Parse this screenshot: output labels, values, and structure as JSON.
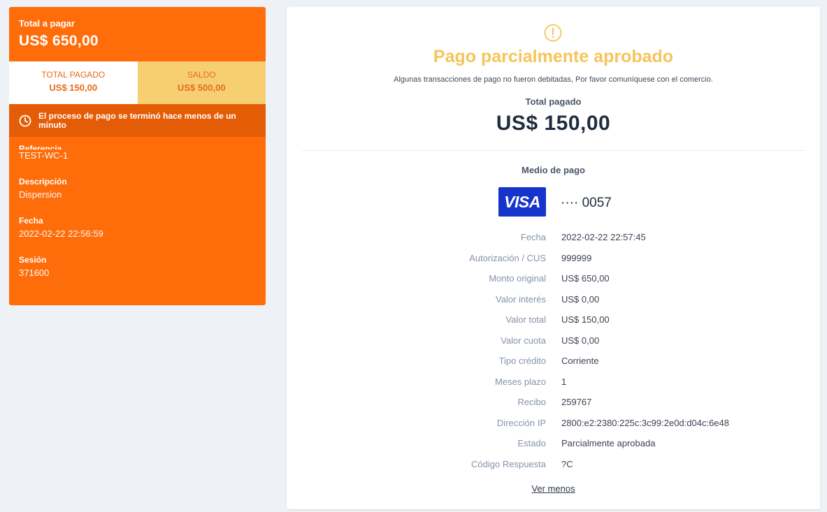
{
  "summary": {
    "total_label": "Total a pagar",
    "total_amount": "US$ 650,00",
    "paid_label": "TOTAL PAGADO",
    "paid_amount": "US$ 150,00",
    "balance_label": "SALDO",
    "balance_amount": "US$ 500,00",
    "notice": "El proceso de pago se terminó hace menos de un minuto",
    "fields": [
      {
        "label": "Referencia",
        "value": "TEST-WC-1"
      },
      {
        "label": "Descripción",
        "value": "Dispersion"
      },
      {
        "label": "Fecha",
        "value": "2022-02-22 22:56:59"
      },
      {
        "label": "Sesión",
        "value": "371600"
      }
    ]
  },
  "detail": {
    "status_title": "Pago parcialmente aprobado",
    "status_message": "Algunas transacciones de pago no fueron debitadas, Por favor comuníquese con el comercio.",
    "total_paid_label": "Total pagado",
    "total_paid_amount": "US$ 150,00",
    "payment_method_label": "Medio de pago",
    "card_brand": "VISA",
    "card_number": "···· 0057",
    "facts": [
      {
        "label": "Fecha",
        "value": "2022-02-22 22:57:45"
      },
      {
        "label": "Autorización / CUS",
        "value": "999999"
      },
      {
        "label": "Monto original",
        "value": "US$ 650,00"
      },
      {
        "label": "Valor interés",
        "value": "US$ 0,00"
      },
      {
        "label": "Valor total",
        "value": "US$ 150,00"
      },
      {
        "label": "Valor cuota",
        "value": "US$ 0,00"
      },
      {
        "label": "Tipo crédito",
        "value": "Corriente"
      },
      {
        "label": "Meses plazo",
        "value": "1"
      },
      {
        "label": "Recibo",
        "value": "259767"
      },
      {
        "label": "Dirección IP",
        "value": "2800:e2:2380:225c:3c99:2e0d:d04c:6e48"
      },
      {
        "label": "Estado",
        "value": "Parcialmente aprobada"
      },
      {
        "label": "Código Respuesta",
        "value": "?C"
      }
    ],
    "toggle_label": "Ver menos"
  },
  "colors": {
    "brand_orange": "#ff6d0b",
    "notice_orange": "#e55c06",
    "balance_yellow": "#f7cf73",
    "warning_yellow": "#f6c55a",
    "visa_blue": "#1434cb"
  },
  "icons": {
    "notice": "clock-icon",
    "status": "warning-circle-icon",
    "card": "visa-logo"
  }
}
